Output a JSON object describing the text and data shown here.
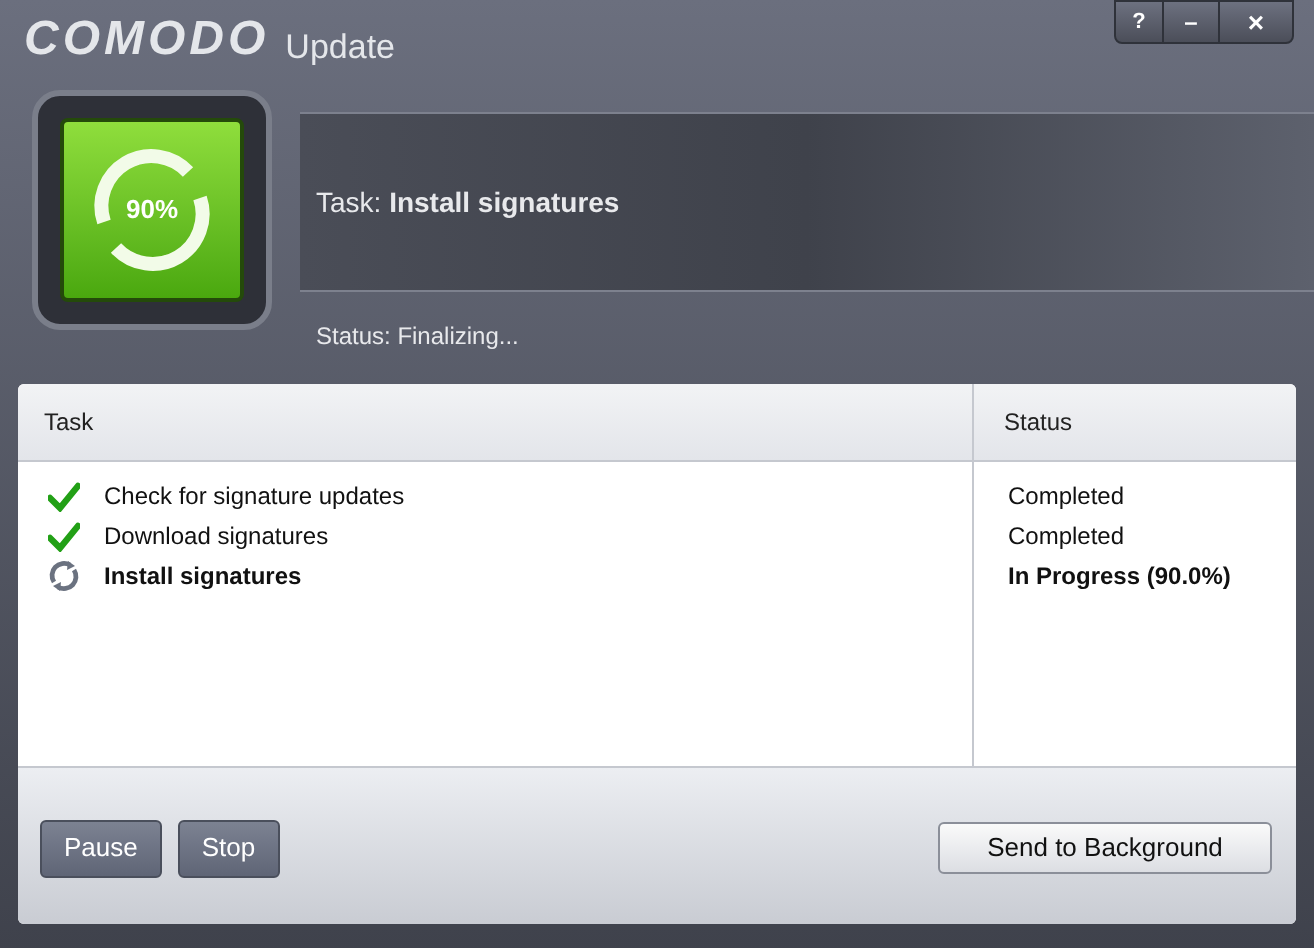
{
  "window": {
    "brand": "COMODO",
    "title": "Update",
    "buttons": [
      "?",
      "–",
      "×"
    ]
  },
  "progress": {
    "percent": "90%"
  },
  "task": {
    "label": "Task:",
    "value": "Install signatures"
  },
  "status": {
    "text": "Status: Finalizing..."
  },
  "table": {
    "columns": [
      "Task",
      "Status"
    ],
    "rows": [
      {
        "kind": "done",
        "task": "Check for signature updates",
        "status": "Completed"
      },
      {
        "kind": "done",
        "task": "Download signatures",
        "status": "Completed"
      },
      {
        "kind": "running",
        "task": "Install signatures",
        "status": "In Progress (90.0%)"
      }
    ]
  },
  "footer": {
    "left_buttons": [
      "Pause",
      "Stop"
    ],
    "right_button": "Send to Background"
  }
}
